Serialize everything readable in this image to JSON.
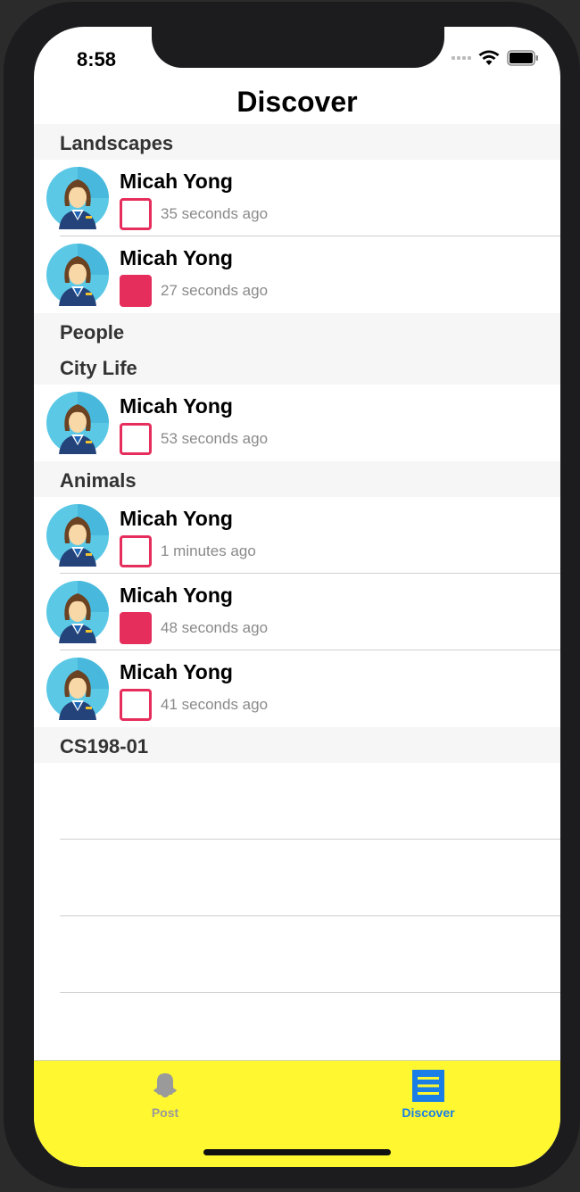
{
  "status": {
    "time": "8:58"
  },
  "title": "Discover",
  "sections": [
    {
      "label": "Landscapes"
    },
    {
      "label": "People"
    },
    {
      "label": "City Life"
    },
    {
      "label": "Animals"
    },
    {
      "label": "CS198-01"
    }
  ],
  "rows": [
    {
      "name": "Micah Yong",
      "time": "35 seconds ago",
      "opened": false
    },
    {
      "name": "Micah Yong",
      "time": "27 seconds ago",
      "opened": true
    },
    {
      "name": "Micah Yong",
      "time": "53 seconds ago",
      "opened": false
    },
    {
      "name": "Micah Yong",
      "time": "1 minutes ago",
      "opened": false
    },
    {
      "name": "Micah Yong",
      "time": "48 seconds ago",
      "opened": true
    },
    {
      "name": "Micah Yong",
      "time": "41 seconds ago",
      "opened": false
    }
  ],
  "tabs": [
    {
      "label": "Post",
      "icon": "ghost-icon"
    },
    {
      "label": "Discover",
      "icon": "list-icon",
      "selected": true
    }
  ],
  "colors": {
    "accent": "#e62e5d",
    "tabbar": "#fff830",
    "selected_tab": "#1a7ee6"
  }
}
